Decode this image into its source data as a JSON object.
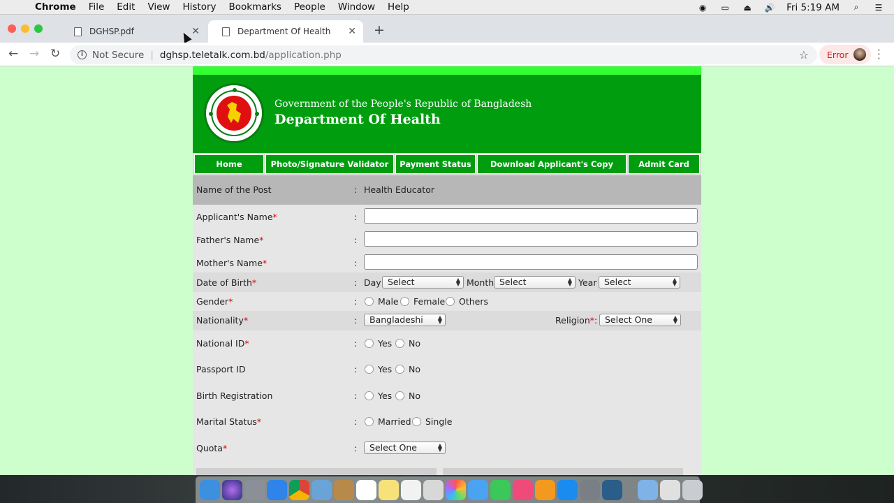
{
  "menubar": {
    "app": "Chrome",
    "items": [
      "File",
      "Edit",
      "View",
      "History",
      "Bookmarks",
      "People",
      "Window",
      "Help"
    ],
    "clock": "Fri 5:19 AM"
  },
  "tabs": [
    {
      "title": "DGHSP.pdf",
      "active": false
    },
    {
      "title": "Department Of Health",
      "active": true
    }
  ],
  "toolbar": {
    "security_label": "Not Secure",
    "url_host": "dghsp.teletalk.com.bd",
    "url_path": "/application.php",
    "error_label": "Error"
  },
  "header": {
    "government_line": "Government of the People's Republic of Bangladesh",
    "department_line": "Department Of Health"
  },
  "nav": [
    "Home",
    "Photo/Signature Validator",
    "Payment Status",
    "Download Applicant's Copy",
    "Admit Card"
  ],
  "form": {
    "colon": ":",
    "required_mark": "*",
    "post": {
      "label": "Name of the Post",
      "value": "Health Educator"
    },
    "applicant_name": {
      "label": "Applicant's Name",
      "value": ""
    },
    "father_name": {
      "label": "Father's Name",
      "value": ""
    },
    "mother_name": {
      "label": "Mother's Name",
      "value": ""
    },
    "dob": {
      "label": "Date of Birth",
      "day_label": "Day",
      "day_value": "Select",
      "month_label": "Month",
      "month_value": "Select",
      "year_label": "Year",
      "year_value": "Select"
    },
    "gender": {
      "label": "Gender",
      "options": [
        "Male",
        "Female",
        "Others"
      ]
    },
    "nationality": {
      "label": "Nationality",
      "value": "Bangladeshi"
    },
    "religion": {
      "label": "Religion",
      "value": "Select One"
    },
    "national_id": {
      "label": "National ID",
      "options": [
        "Yes",
        "No"
      ]
    },
    "passport_id": {
      "label": "Passport ID",
      "options": [
        "Yes",
        "No"
      ]
    },
    "birth_registration": {
      "label": "Birth Registration",
      "options": [
        "Yes",
        "No"
      ]
    },
    "marital_status": {
      "label": "Marital Status",
      "options": [
        "Married",
        "Single"
      ]
    },
    "quota": {
      "label": "Quota",
      "value": "Select One"
    }
  },
  "colors": {
    "header_green": "#009e0f",
    "page_bg": "#ccffcc",
    "required": "#dd0000"
  }
}
